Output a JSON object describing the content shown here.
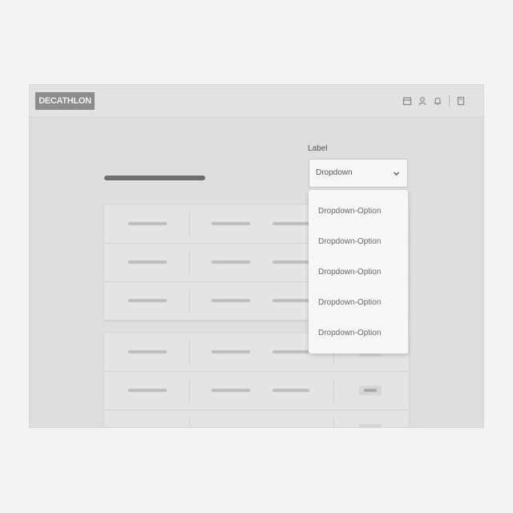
{
  "header": {
    "logo_text": "DECATHLON",
    "icons": [
      "calendar-icon",
      "user-icon",
      "bell-icon",
      "file-icon"
    ]
  },
  "form": {
    "label": "Label",
    "select_value": "Dropdown"
  },
  "dropdown": {
    "options": [
      "Dropdown-Option",
      "Dropdown-Option",
      "Dropdown-Option",
      "Dropdown-Option",
      "Dropdown-Option"
    ]
  }
}
